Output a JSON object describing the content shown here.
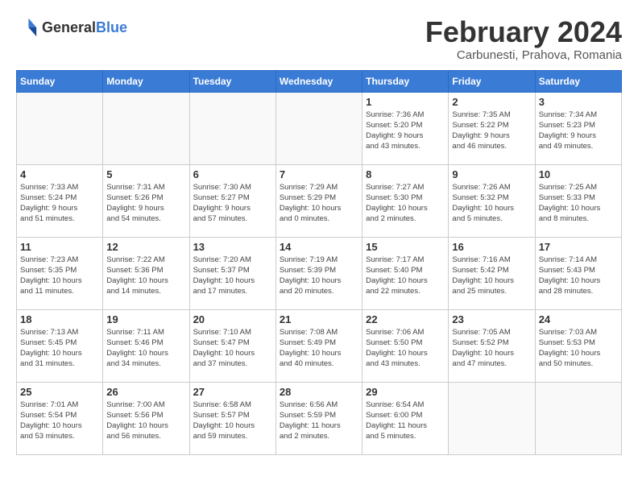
{
  "header": {
    "logo_general": "General",
    "logo_blue": "Blue",
    "title": "February 2024",
    "subtitle": "Carbunesti, Prahova, Romania"
  },
  "weekdays": [
    "Sunday",
    "Monday",
    "Tuesday",
    "Wednesday",
    "Thursday",
    "Friday",
    "Saturday"
  ],
  "weeks": [
    [
      {
        "day": "",
        "info": ""
      },
      {
        "day": "",
        "info": ""
      },
      {
        "day": "",
        "info": ""
      },
      {
        "day": "",
        "info": ""
      },
      {
        "day": "1",
        "info": "Sunrise: 7:36 AM\nSunset: 5:20 PM\nDaylight: 9 hours\nand 43 minutes."
      },
      {
        "day": "2",
        "info": "Sunrise: 7:35 AM\nSunset: 5:22 PM\nDaylight: 9 hours\nand 46 minutes."
      },
      {
        "day": "3",
        "info": "Sunrise: 7:34 AM\nSunset: 5:23 PM\nDaylight: 9 hours\nand 49 minutes."
      }
    ],
    [
      {
        "day": "4",
        "info": "Sunrise: 7:33 AM\nSunset: 5:24 PM\nDaylight: 9 hours\nand 51 minutes."
      },
      {
        "day": "5",
        "info": "Sunrise: 7:31 AM\nSunset: 5:26 PM\nDaylight: 9 hours\nand 54 minutes."
      },
      {
        "day": "6",
        "info": "Sunrise: 7:30 AM\nSunset: 5:27 PM\nDaylight: 9 hours\nand 57 minutes."
      },
      {
        "day": "7",
        "info": "Sunrise: 7:29 AM\nSunset: 5:29 PM\nDaylight: 10 hours\nand 0 minutes."
      },
      {
        "day": "8",
        "info": "Sunrise: 7:27 AM\nSunset: 5:30 PM\nDaylight: 10 hours\nand 2 minutes."
      },
      {
        "day": "9",
        "info": "Sunrise: 7:26 AM\nSunset: 5:32 PM\nDaylight: 10 hours\nand 5 minutes."
      },
      {
        "day": "10",
        "info": "Sunrise: 7:25 AM\nSunset: 5:33 PM\nDaylight: 10 hours\nand 8 minutes."
      }
    ],
    [
      {
        "day": "11",
        "info": "Sunrise: 7:23 AM\nSunset: 5:35 PM\nDaylight: 10 hours\nand 11 minutes."
      },
      {
        "day": "12",
        "info": "Sunrise: 7:22 AM\nSunset: 5:36 PM\nDaylight: 10 hours\nand 14 minutes."
      },
      {
        "day": "13",
        "info": "Sunrise: 7:20 AM\nSunset: 5:37 PM\nDaylight: 10 hours\nand 17 minutes."
      },
      {
        "day": "14",
        "info": "Sunrise: 7:19 AM\nSunset: 5:39 PM\nDaylight: 10 hours\nand 20 minutes."
      },
      {
        "day": "15",
        "info": "Sunrise: 7:17 AM\nSunset: 5:40 PM\nDaylight: 10 hours\nand 22 minutes."
      },
      {
        "day": "16",
        "info": "Sunrise: 7:16 AM\nSunset: 5:42 PM\nDaylight: 10 hours\nand 25 minutes."
      },
      {
        "day": "17",
        "info": "Sunrise: 7:14 AM\nSunset: 5:43 PM\nDaylight: 10 hours\nand 28 minutes."
      }
    ],
    [
      {
        "day": "18",
        "info": "Sunrise: 7:13 AM\nSunset: 5:45 PM\nDaylight: 10 hours\nand 31 minutes."
      },
      {
        "day": "19",
        "info": "Sunrise: 7:11 AM\nSunset: 5:46 PM\nDaylight: 10 hours\nand 34 minutes."
      },
      {
        "day": "20",
        "info": "Sunrise: 7:10 AM\nSunset: 5:47 PM\nDaylight: 10 hours\nand 37 minutes."
      },
      {
        "day": "21",
        "info": "Sunrise: 7:08 AM\nSunset: 5:49 PM\nDaylight: 10 hours\nand 40 minutes."
      },
      {
        "day": "22",
        "info": "Sunrise: 7:06 AM\nSunset: 5:50 PM\nDaylight: 10 hours\nand 43 minutes."
      },
      {
        "day": "23",
        "info": "Sunrise: 7:05 AM\nSunset: 5:52 PM\nDaylight: 10 hours\nand 47 minutes."
      },
      {
        "day": "24",
        "info": "Sunrise: 7:03 AM\nSunset: 5:53 PM\nDaylight: 10 hours\nand 50 minutes."
      }
    ],
    [
      {
        "day": "25",
        "info": "Sunrise: 7:01 AM\nSunset: 5:54 PM\nDaylight: 10 hours\nand 53 minutes."
      },
      {
        "day": "26",
        "info": "Sunrise: 7:00 AM\nSunset: 5:56 PM\nDaylight: 10 hours\nand 56 minutes."
      },
      {
        "day": "27",
        "info": "Sunrise: 6:58 AM\nSunset: 5:57 PM\nDaylight: 10 hours\nand 59 minutes."
      },
      {
        "day": "28",
        "info": "Sunrise: 6:56 AM\nSunset: 5:59 PM\nDaylight: 11 hours\nand 2 minutes."
      },
      {
        "day": "29",
        "info": "Sunrise: 6:54 AM\nSunset: 6:00 PM\nDaylight: 11 hours\nand 5 minutes."
      },
      {
        "day": "",
        "info": ""
      },
      {
        "day": "",
        "info": ""
      }
    ]
  ]
}
